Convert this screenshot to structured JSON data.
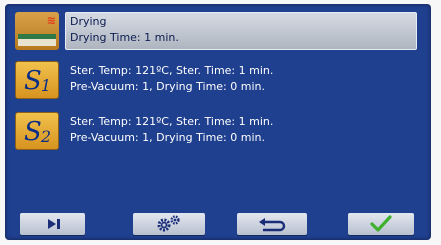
{
  "programs": [
    {
      "icon": "drying-icon",
      "selected": true,
      "line1": "Drying",
      "line2": "Drying Time: 1 min."
    },
    {
      "icon": "program-s1-icon",
      "icon_letter": "S",
      "icon_number": "1",
      "selected": false,
      "line1": "Ster. Temp: 121ºC, Ster. Time: 1 min.",
      "line2": "Pre-Vacuum: 1, Drying Time: 0 min."
    },
    {
      "icon": "program-s2-icon",
      "icon_letter": "S",
      "icon_number": "2",
      "selected": false,
      "line1": "Ster. Temp: 121ºC, Ster. Time: 1 min.",
      "line2": "Pre-Vacuum: 1, Drying Time: 0 min."
    }
  ],
  "buttons": [
    {
      "name": "next-button",
      "icon": "skip-next-icon"
    },
    {
      "name": "settings-button",
      "icon": "gears-icon"
    },
    {
      "name": "back-button",
      "icon": "return-arrow-icon"
    },
    {
      "name": "confirm-button",
      "icon": "checkmark-icon"
    }
  ],
  "colors": {
    "screen_background": "#1f3f8f",
    "selection_highlight": "#c3c9d4",
    "program_tile": "#e3aa35",
    "confirm_check": "#3fb12e",
    "button_icon": "#1a2d78"
  }
}
